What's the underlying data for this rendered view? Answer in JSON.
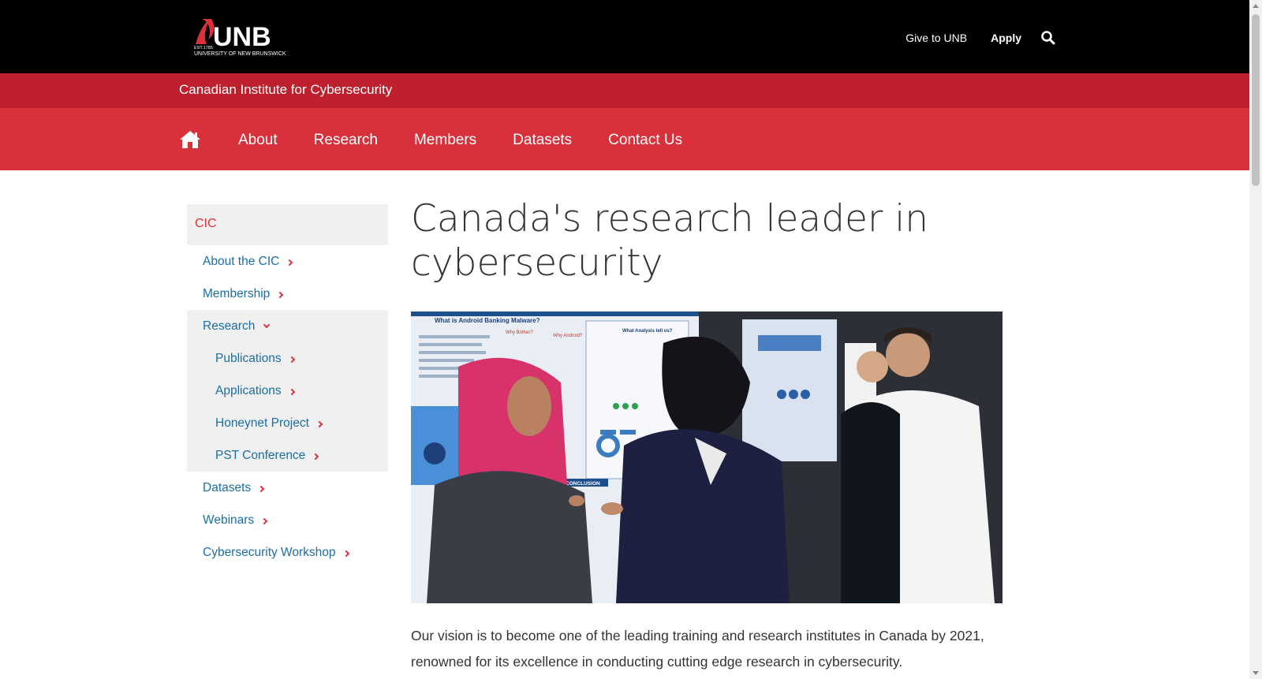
{
  "header": {
    "logo_wordmark": "UNB",
    "logo_est": "EST.1785",
    "logo_subtitle": "UNIVERSITY OF NEW BRUNSWICK",
    "links": [
      {
        "label": "Give to UNB"
      },
      {
        "label": "Apply"
      }
    ],
    "search_icon": "search-icon"
  },
  "institute": {
    "name": "Canadian Institute for Cybersecurity"
  },
  "nav": {
    "home_icon": "home-icon",
    "items": [
      {
        "label": "About"
      },
      {
        "label": "Research"
      },
      {
        "label": "Members"
      },
      {
        "label": "Datasets"
      },
      {
        "label": "Contact Us"
      }
    ]
  },
  "sidebar": {
    "heading": "CIC",
    "items": [
      {
        "label": "About the CIC"
      },
      {
        "label": "Membership"
      },
      {
        "label": "Research"
      },
      {
        "label": "Publications"
      },
      {
        "label": "Applications"
      },
      {
        "label": "Honeynet Project"
      },
      {
        "label": "PST Conference"
      },
      {
        "label": "Datasets"
      },
      {
        "label": "Webinars"
      },
      {
        "label": "Cybersecurity Workshop"
      }
    ]
  },
  "main": {
    "title": "Canada's research leader in cybersecurity",
    "hero_image": "photo of researchers presenting posters",
    "poster_texts": [
      "What is Android Banking Malware?",
      "Why Bother?",
      "Why Android?",
      "What Analysis tell us?",
      "CONCLUSION"
    ],
    "vision": "Our vision is to become one of the leading training and research institutes in Canada by 2021, renowned for its excellence in conducting cutting edge research in cybersecurity."
  },
  "colors": {
    "topbar": "#000000",
    "institute_bar": "#be202e",
    "nav_bar": "#d9313c",
    "link": "#1a6fa3",
    "accent": "#d9313c"
  }
}
